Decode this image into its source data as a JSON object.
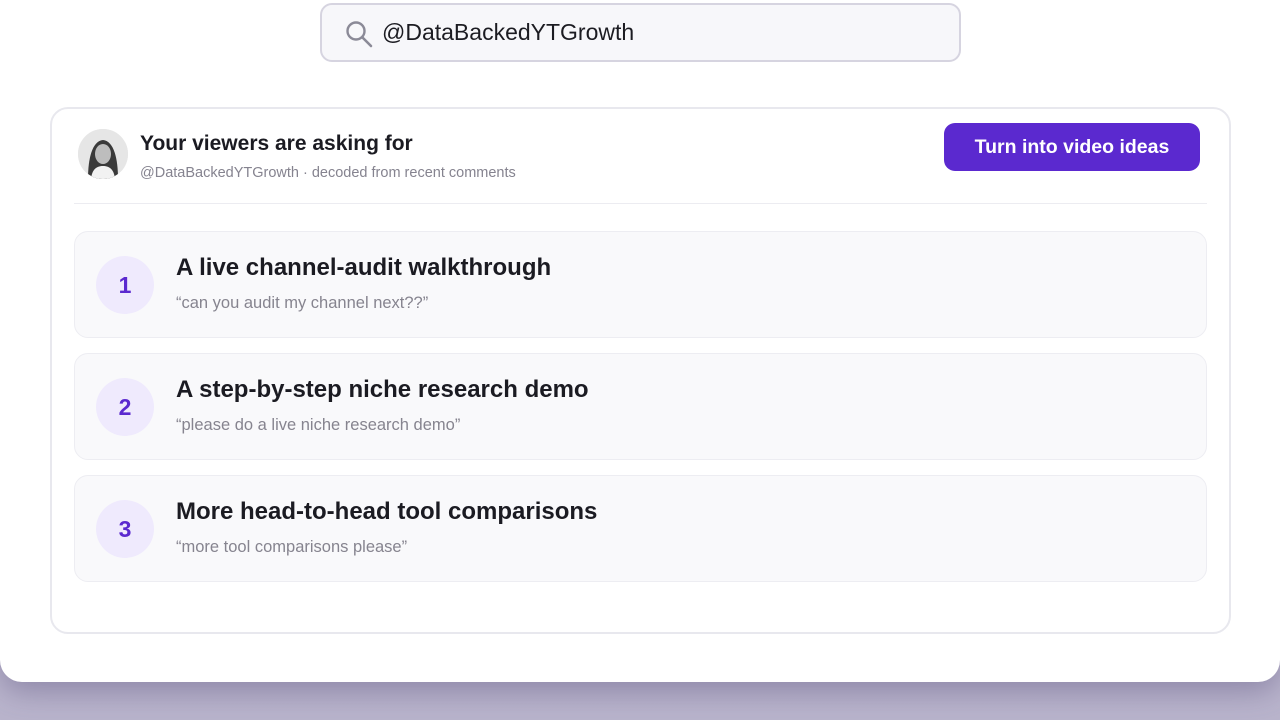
{
  "search": {
    "value": "@DataBackedYTGrowth"
  },
  "card": {
    "title": "Your viewers are asking for",
    "subtitle": "@DataBackedYTGrowth · decoded from recent comments",
    "cta_label": "Turn into video ideas"
  },
  "requests": [
    {
      "rank": "1",
      "title": "A live channel-audit walkthrough",
      "quote": "“can you audit my channel next??”"
    },
    {
      "rank": "2",
      "title": "A step-by-step niche research demo",
      "quote": "“please do a live niche research demo”"
    },
    {
      "rank": "3",
      "title": "More head-to-head tool comparisons",
      "quote": "“more tool comparisons please”"
    }
  ],
  "colors": {
    "accent": "#5b29cf",
    "badge_bg": "#efeafd"
  }
}
